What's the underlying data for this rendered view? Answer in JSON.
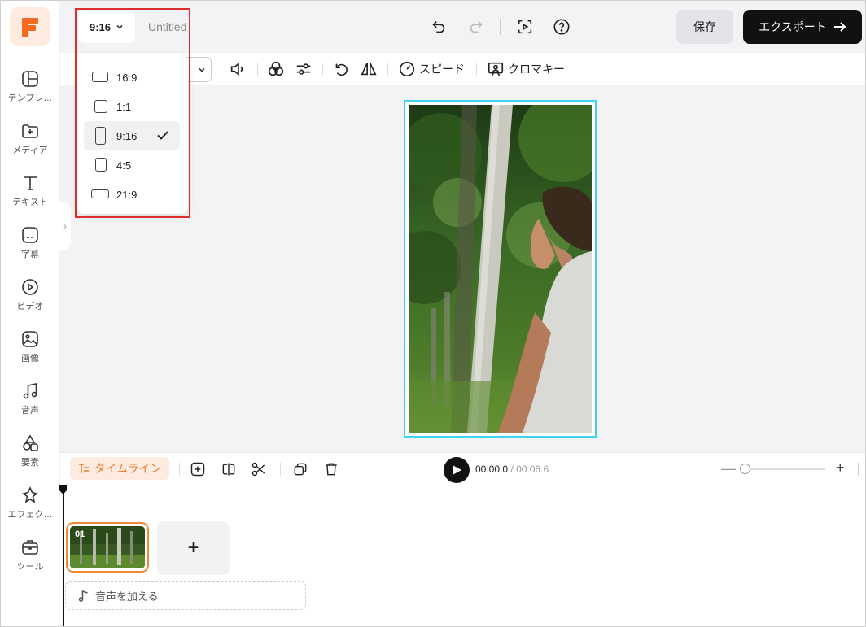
{
  "app": {
    "brand_color": "#f26b21",
    "accent": "#3fd4e8"
  },
  "sidebar": {
    "items": [
      {
        "label": "テンプレ…",
        "icon": "template-icon"
      },
      {
        "label": "メディア",
        "icon": "media-folder-icon"
      },
      {
        "label": "テキスト",
        "icon": "text-icon"
      },
      {
        "label": "字幕",
        "icon": "subtitle-icon"
      },
      {
        "label": "ビデオ",
        "icon": "video-icon"
      },
      {
        "label": "画像",
        "icon": "image-icon"
      },
      {
        "label": "音声",
        "icon": "music-icon"
      },
      {
        "label": "要素",
        "icon": "shapes-icon"
      },
      {
        "label": "エフェク…",
        "icon": "effects-icon"
      },
      {
        "label": "ツール",
        "icon": "toolbox-icon"
      }
    ]
  },
  "header": {
    "ratio": "9:16",
    "project_name": "Untitled",
    "save_label": "保存",
    "export_label": "エクスポート"
  },
  "toolbar": {
    "speed_label": "スピード",
    "chroma_label": "クロマキー"
  },
  "aspect_menu": {
    "options": [
      {
        "label": "16:9",
        "selected": false
      },
      {
        "label": "1:1",
        "selected": false
      },
      {
        "label": "9:16",
        "selected": true
      },
      {
        "label": "4:5",
        "selected": false
      },
      {
        "label": "21:9",
        "selected": false
      }
    ]
  },
  "timeline": {
    "tab_label": "タイムライン",
    "current_time": "00:00.0",
    "separator": "/",
    "duration": "00:06.6",
    "clip_number": "01",
    "add_clip": "+",
    "add_audio_label": "音声を加える"
  }
}
